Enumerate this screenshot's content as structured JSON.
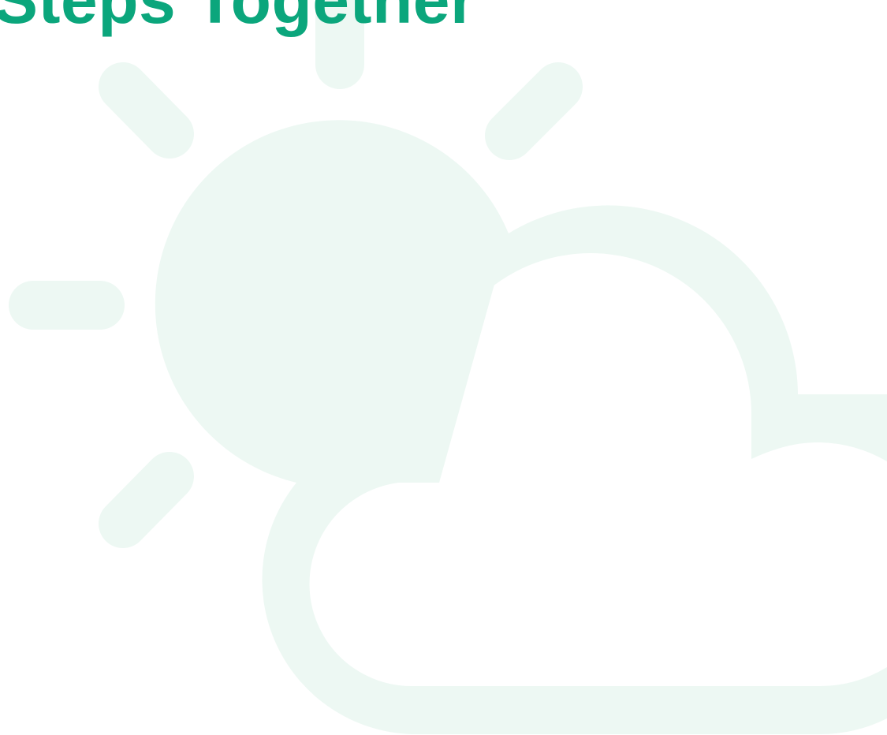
{
  "hero": {
    "title": "Steps Together"
  },
  "illustration": {
    "icon": "partly-cloudy-icon",
    "color": "#edf8f3"
  },
  "colors": {
    "accent": "#0ba67c",
    "background": "#ffffff"
  }
}
